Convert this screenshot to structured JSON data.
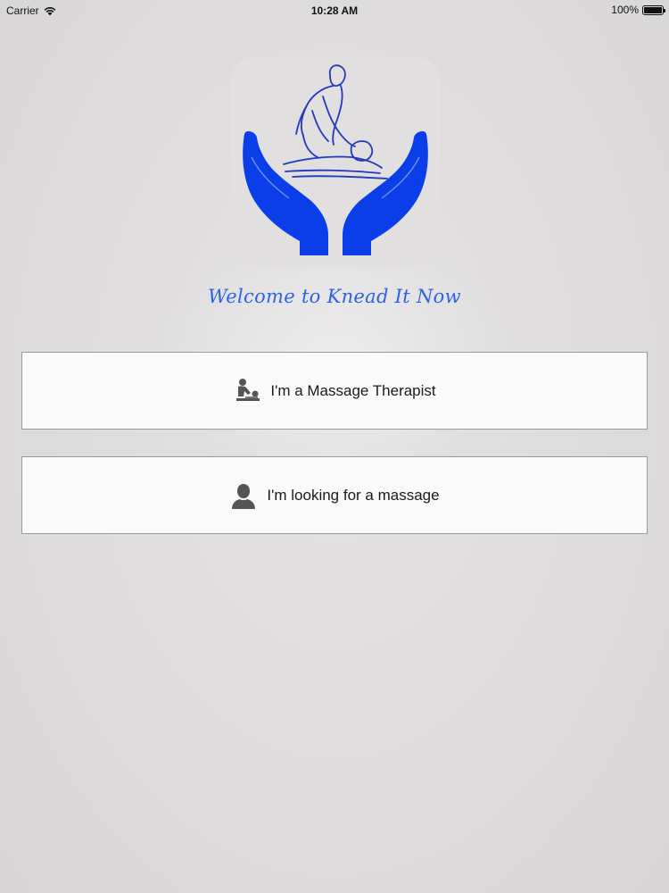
{
  "status_bar": {
    "carrier": "Carrier",
    "time": "10:28 AM",
    "battery": "100%",
    "battery_level": 1.0
  },
  "welcome": {
    "text": "Welcome to Knead It Now"
  },
  "buttons": {
    "therapist": {
      "label": "I'm a Massage Therapist",
      "icon": "massage-therapist-icon"
    },
    "client": {
      "label": "I'm looking for a massage",
      "icon": "person-icon"
    }
  },
  "colors": {
    "brand_blue": "#0a3ee8",
    "welcome_text": "#2a63e6",
    "background": "#dcdadb"
  }
}
